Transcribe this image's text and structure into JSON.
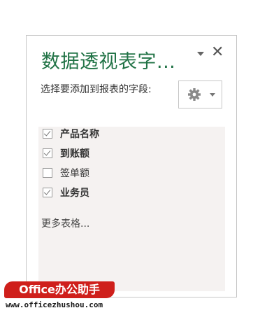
{
  "pane": {
    "title": "数据透视表字...",
    "dropdown_icon": "triangle-down-icon",
    "close_icon": "close-icon",
    "close_glyph": "✕"
  },
  "instruction": "选择要添加到报表的字段:",
  "tools_button": {
    "icon": "gear-icon",
    "chevron": "chevron-down-icon"
  },
  "fields": [
    {
      "label": "产品名称",
      "checked": true
    },
    {
      "label": "到账额",
      "checked": true
    },
    {
      "label": "签单额",
      "checked": false
    },
    {
      "label": "业务员",
      "checked": true
    }
  ],
  "more_tables": "更多表格...",
  "watermark": {
    "brand": "Office办公助手",
    "url": "www.officezhushou.com"
  },
  "colors": {
    "title": "#217346",
    "badge": "#cf1f1b",
    "list_bg": "#f5f2f1"
  }
}
